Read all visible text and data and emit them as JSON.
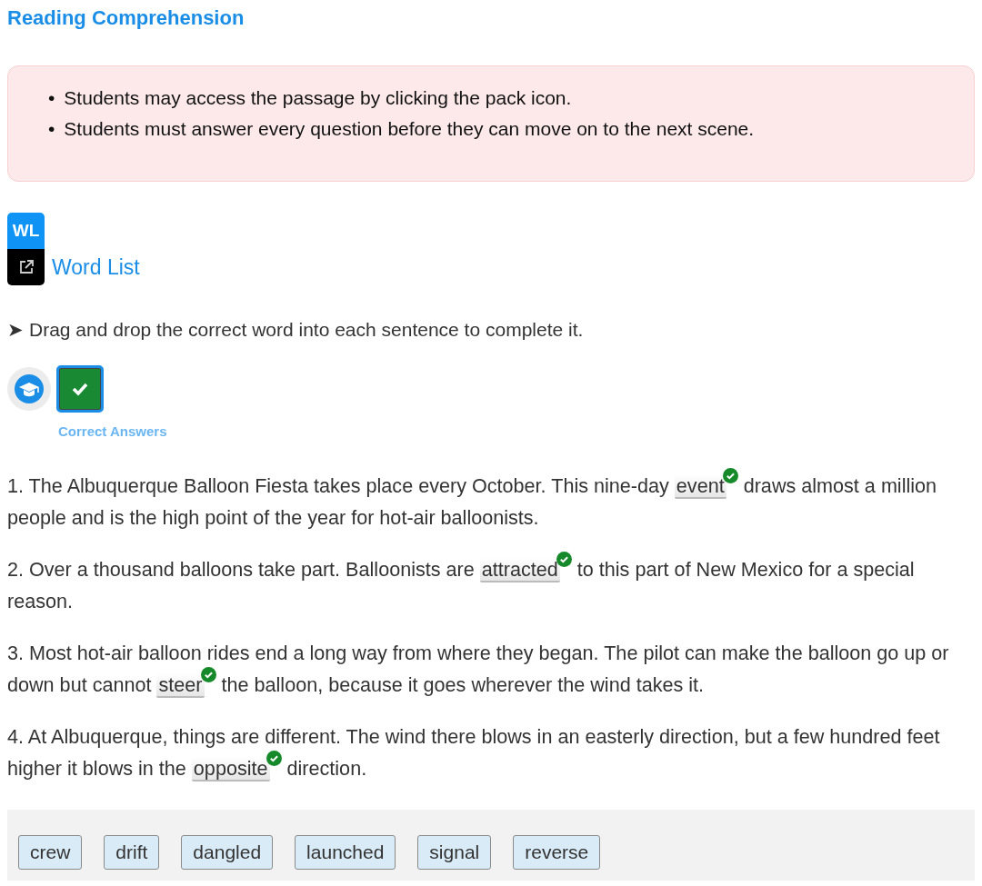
{
  "title": "Reading Comprehension",
  "notes": [
    {
      "bullet": "•",
      "text": "Students may access the passage by clicking the pack icon."
    },
    {
      "bullet": "•",
      "text": "Students must answer every question before they can move on to the next scene."
    }
  ],
  "word_list": {
    "badge": "WL",
    "label": "Word List"
  },
  "instruction": {
    "marker": "➤",
    "text": "Drag and drop the correct word into each sentence to complete it."
  },
  "answer_toggle": {
    "label": "Correct Answers",
    "on": true
  },
  "sentences": [
    {
      "before": "1. The Albuquerque Balloon Fiesta takes place every October. This nine-day",
      "answer": "event",
      "correct": true,
      "after": "draws almost a million people and is the high point of the year for hot-air balloonists."
    },
    {
      "before": "2. Over a thousand balloons take part. Balloonists are",
      "answer": "attracted",
      "correct": true,
      "after": "to this part of New Mexico for a special reason."
    },
    {
      "before": "3. Most hot-air balloon rides end a long way from where they began. The pilot can make the balloon go up or down but cannot",
      "answer": "steer",
      "correct": true,
      "after": "the balloon, because it goes wherever the wind takes it."
    },
    {
      "before": "4. At Albuquerque, things are different. The wind there blows in an easterly direction, but a few hundred feet higher it blows in the",
      "answer": "opposite",
      "correct": true,
      "after": "direction."
    }
  ],
  "word_bank": [
    "crew",
    "drift",
    "dangled",
    "launched",
    "signal",
    "reverse"
  ]
}
